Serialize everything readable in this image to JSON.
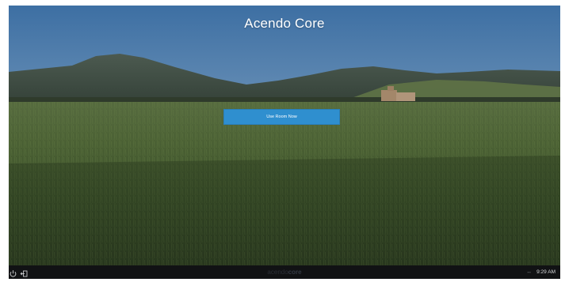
{
  "app": {
    "title": "Acendo Core"
  },
  "main": {
    "cta_label": "Use Room Now"
  },
  "taskbar": {
    "brand_light": "acendo",
    "brand_bold": "core",
    "time": "9:29 AM"
  },
  "icons": {
    "power": "power-icon",
    "exit": "exit-icon",
    "resize": "resize-arrows-icon"
  },
  "colors": {
    "accent": "#2f8fcf",
    "taskbar_bg": "#111214",
    "title_text": "#ffffff"
  }
}
